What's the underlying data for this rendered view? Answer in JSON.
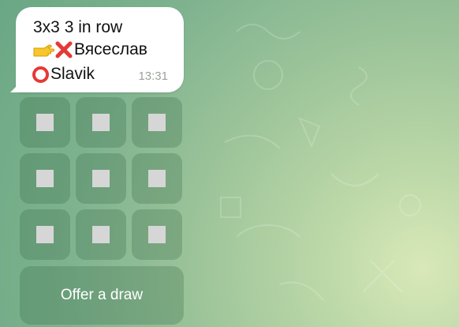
{
  "message": {
    "line_1": "3x3 3 in row",
    "line_2_name": "Вясеслав",
    "line_3_name": "Slavik",
    "time": "13:31"
  },
  "board": {
    "cells": [
      {
        "row": 1,
        "col": 1
      },
      {
        "row": 1,
        "col": 2
      },
      {
        "row": 1,
        "col": 3
      },
      {
        "row": 2,
        "col": 1
      },
      {
        "row": 2,
        "col": 2
      },
      {
        "row": 2,
        "col": 3
      },
      {
        "row": 3,
        "col": 1
      },
      {
        "row": 3,
        "col": 2
      },
      {
        "row": 3,
        "col": 3
      }
    ]
  },
  "actions": {
    "offer_draw_label": "Offer a draw"
  },
  "icons": {
    "turn_indicator": "pointing-right-hand-icon",
    "player_1_mark": "cross-icon",
    "player_2_mark": "circle-icon"
  },
  "colors": {
    "cross": "#e53935",
    "circle": "#e53935",
    "cell_bg": "#37694447",
    "button_text": "#ffffff"
  }
}
